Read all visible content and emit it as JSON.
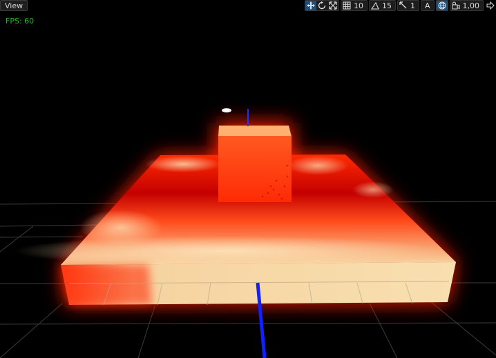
{
  "viewport": {
    "view_label": "View",
    "fps_label": "FPS: 60"
  },
  "toolbar": {
    "grid_snap_value": "10",
    "angle_snap_value": "15",
    "scale_snap_value": "1",
    "auto_label": "A",
    "camera_speed_value": "1,00"
  },
  "colors": {
    "background": "#000000",
    "fps_text": "#2fb830",
    "active_tool": "#1d4f79",
    "glow_red": "#ff1a00",
    "hot_white": "#f5dcaa",
    "axis_blue": "#1020ff"
  }
}
